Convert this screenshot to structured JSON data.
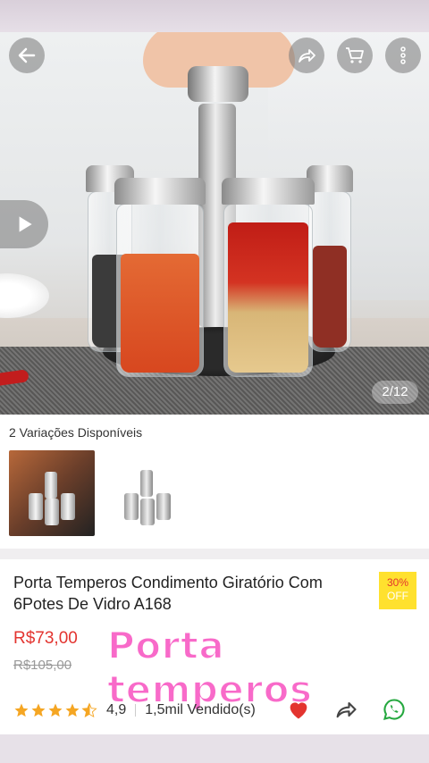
{
  "header": {
    "icons": [
      "back-arrow-icon",
      "share-icon",
      "cart-icon",
      "more-icon"
    ]
  },
  "gallery": {
    "page_indicator": "2/12",
    "play_icon": "play-icon"
  },
  "variations": {
    "title": "2 Variações Disponíveis"
  },
  "product": {
    "title": "Porta Temperos Condimento Giratório Com 6Potes De Vidro A168",
    "discount_percent": "30%",
    "discount_label": "OFF",
    "price": "R$73,00",
    "old_price": "R$105,00",
    "overlay_text": "Porta temperos",
    "rating": "4,9",
    "sold": "1,5mil Vendido(s)"
  },
  "colors": {
    "accent_red": "#e3342f",
    "badge_yellow": "#ffe12e",
    "overlay_pink": "#f86ac9",
    "star": "#f5a623",
    "whatsapp_green": "#25a83f"
  }
}
